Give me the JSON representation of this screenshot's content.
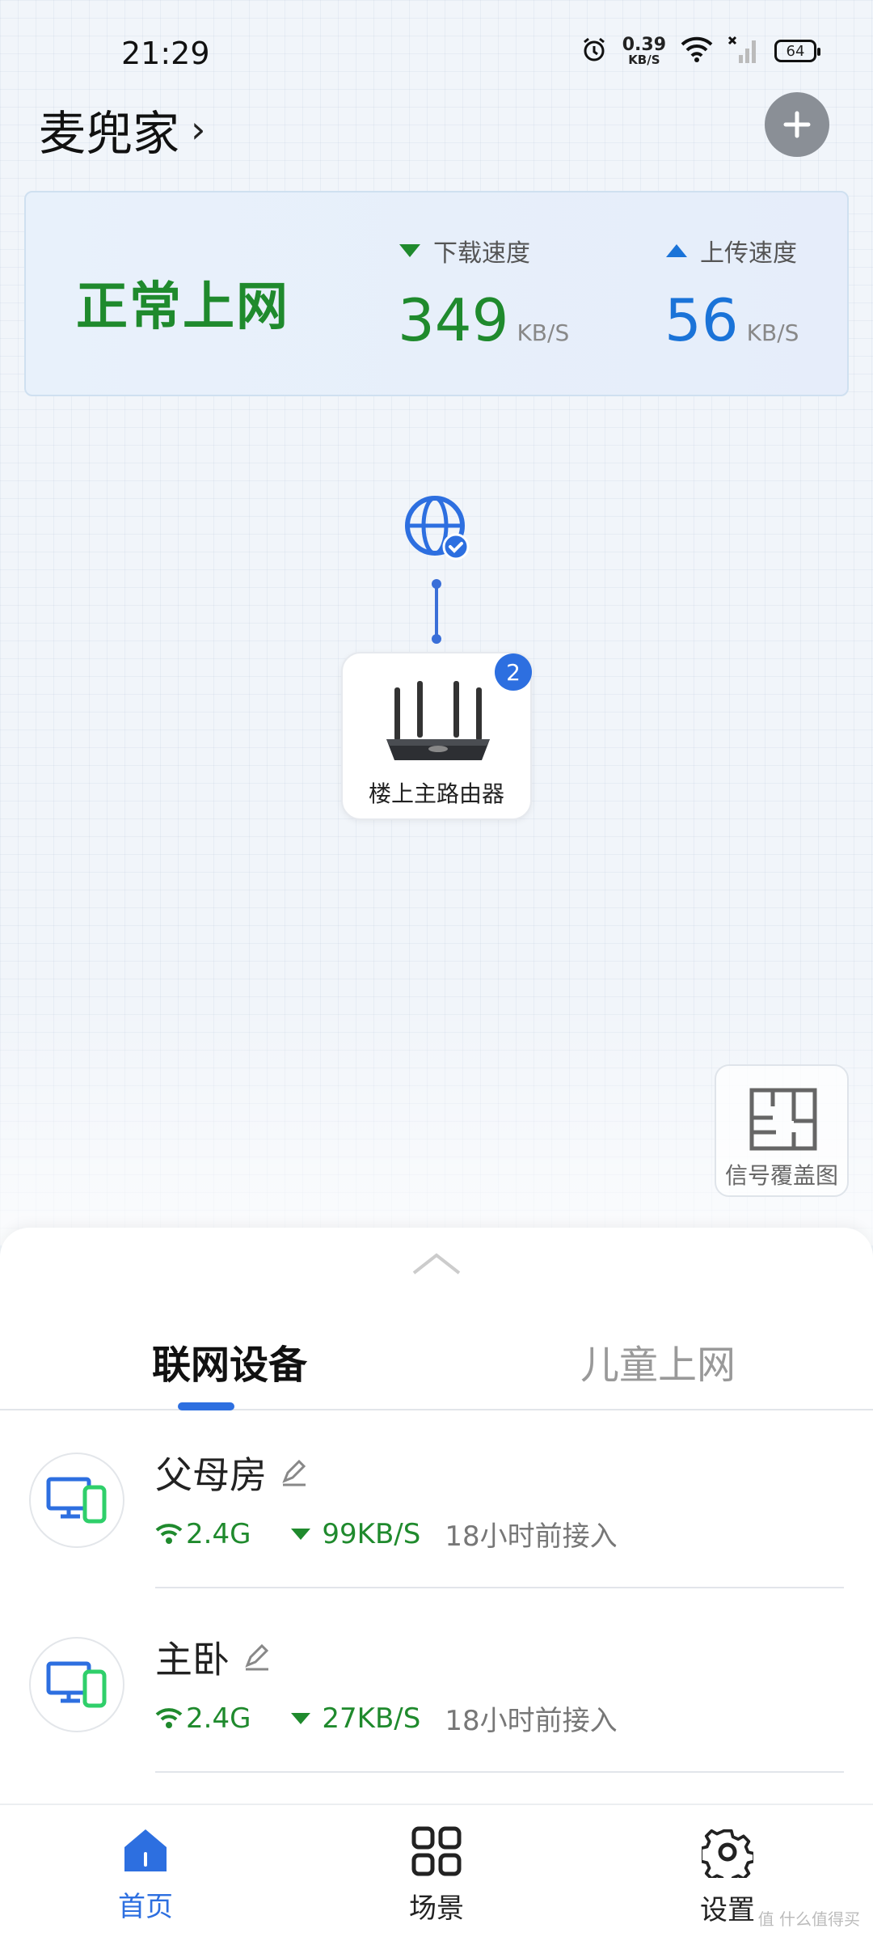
{
  "status_bar": {
    "time": "21:29",
    "net_speed_value": "0.39",
    "net_speed_unit": "KB/S",
    "battery": "64",
    "icons": [
      "alarm-icon",
      "wifi-icon",
      "cellular-off-icon",
      "battery-icon"
    ]
  },
  "header": {
    "home_name": "麦兜家",
    "chevron": "›"
  },
  "speed_card": {
    "status": "正常上网",
    "download_label": "下载速度",
    "download_value": "349",
    "download_unit": "KB/S",
    "upload_label": "上传速度",
    "upload_value": "56",
    "upload_unit": "KB/S",
    "colors": {
      "status": "#1f8a2d",
      "download": "#1f8a2d",
      "upload": "#1a73d8"
    }
  },
  "topology": {
    "router_name": "楼上主路由器",
    "router_badge": "2"
  },
  "coverage": {
    "label": "信号覆盖图"
  },
  "sheet": {
    "tabs": [
      {
        "label": "联网设备",
        "active": true
      },
      {
        "label": "儿童上网",
        "active": false
      }
    ],
    "devices": [
      {
        "name": "父母房",
        "band": "2.4G",
        "rate": "99KB/S",
        "connected": "18小时前接入"
      },
      {
        "name": "主卧",
        "band": "2.4G",
        "rate": "27KB/S",
        "connected": "18小时前接入"
      }
    ]
  },
  "bottom_nav": {
    "items": [
      {
        "label": "首页",
        "icon": "home-icon",
        "active": true
      },
      {
        "label": "场景",
        "icon": "grid-icon",
        "active": false
      },
      {
        "label": "设置",
        "icon": "gear-icon",
        "active": false
      }
    ],
    "accent": "#2d6fe0"
  },
  "watermark": "值 什么值得买"
}
